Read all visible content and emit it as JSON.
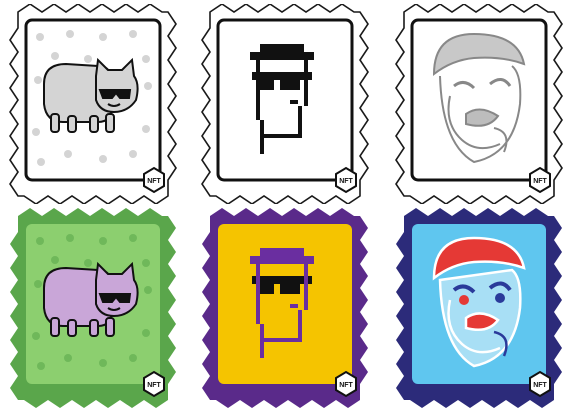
{
  "badge_text": "NFT",
  "stamps": [
    {
      "row": "top",
      "subject": "cat-with-sunglasses",
      "style": "outline",
      "frame_fill": "#ffffff",
      "frame_stroke": "#1a1a1a",
      "card_fill": "#ffffff",
      "accent": "#d4d4d4"
    },
    {
      "row": "top",
      "subject": "pixel-man-hat-sunglasses",
      "style": "outline",
      "frame_fill": "#ffffff",
      "frame_stroke": "#1a1a1a",
      "card_fill": "#ffffff",
      "accent": "#111111"
    },
    {
      "row": "top",
      "subject": "abstract-face",
      "style": "outline",
      "frame_fill": "#ffffff",
      "frame_stroke": "#1a1a1a",
      "card_fill": "#ffffff",
      "accent": "#bdbdbd"
    },
    {
      "row": "bottom",
      "subject": "cat-with-sunglasses",
      "style": "color",
      "frame_fill": "#5aa64b",
      "card_fill": "#8ccf6f",
      "accent": "#c9a6d8"
    },
    {
      "row": "bottom",
      "subject": "pixel-man-hat-sunglasses",
      "style": "color",
      "frame_fill": "#5a2a8a",
      "card_fill": "#f5c400",
      "accent": "#6a2ea0"
    },
    {
      "row": "bottom",
      "subject": "abstract-face",
      "style": "color",
      "frame_fill": "#2c2b7a",
      "card_fill": "#5fc6ef",
      "accent": "#e53935"
    }
  ]
}
